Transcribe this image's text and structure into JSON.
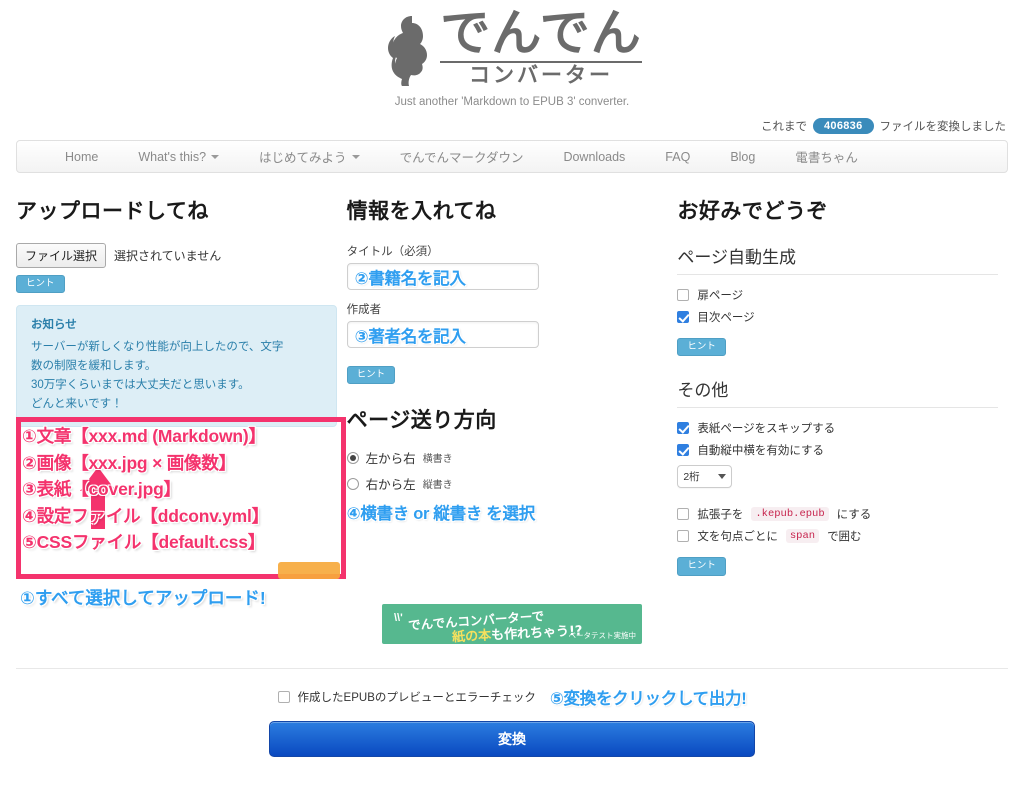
{
  "site": {
    "logo_main": "でんでん",
    "logo_sub": "コンバーター",
    "tagline": "Just another 'Markdown to EPUB 3' converter."
  },
  "counter": {
    "prefix": "これまで",
    "count": "406836",
    "suffix": "ファイルを変換しました"
  },
  "nav": {
    "items": [
      {
        "label": "Home",
        "caret": false
      },
      {
        "label": "What's this?",
        "caret": true
      },
      {
        "label": "はじめてみよう",
        "caret": true
      },
      {
        "label": "でんでんマークダウン",
        "caret": false
      },
      {
        "label": "Downloads",
        "caret": false
      },
      {
        "label": "FAQ",
        "caret": false
      },
      {
        "label": "Blog",
        "caret": false
      },
      {
        "label": "電書ちゃん",
        "caret": false
      }
    ]
  },
  "upload": {
    "heading": "アップロードしてね",
    "file_button": "ファイル選択",
    "file_status": "選択されていません",
    "hint_label": "ヒント",
    "notice": {
      "title": "お知らせ",
      "line1": "サーバーが新しくなり性能が向上したので、文字",
      "line2": "数の制限を緩和します。",
      "line3": "30万字くらいまでは大丈夫だと思います。",
      "line4": "どんと来いです！"
    },
    "annotation_list": [
      "①文章【xxx.md (Markdown)】",
      "②画像【xxx.jpg × 画像数】",
      "③表紙【cover.jpg】",
      "④設定ファイル【ddconv.yml】",
      "⑤CSSファイル【default.css】"
    ],
    "annotation_bottom": "①すべて選択してアップロード!"
  },
  "info": {
    "heading": "情報を入れてね",
    "title_label": "タイトル（必須）",
    "title_value": "②書籍名を記入",
    "title_placeholder": "",
    "author_label": "作成者",
    "author_value": "③著者名を記入",
    "author_placeholder": "",
    "hint_label": "ヒント",
    "direction_heading": "ページ送り方向",
    "radios": [
      {
        "main": "左から右",
        "sub": "横書き",
        "checked": true
      },
      {
        "main": "右から左",
        "sub": "縦書き",
        "checked": false
      }
    ],
    "annotation": "④横書き or 縦書き を選択"
  },
  "options": {
    "heading": "お好みでどうぞ",
    "autogen_heading": "ページ自動生成",
    "autogen_items": [
      {
        "label": "扉ページ",
        "checked": false
      },
      {
        "label": "目次ページ",
        "checked": true
      }
    ],
    "autogen_hint": "ヒント",
    "other_heading": "その他",
    "other_items": [
      {
        "label": "表紙ページをスキップする",
        "checked": true
      },
      {
        "label": "自動縦中横を有効にする",
        "checked": true
      }
    ],
    "digit_select": "2桁",
    "ext_item": {
      "pre": "拡張子を",
      "code": ".kepub.epub",
      "post": "にする",
      "checked": false
    },
    "span_item": {
      "pre": "文を句点ごとに",
      "code": "span",
      "post": "で囲む",
      "checked": false
    },
    "other_hint": "ヒント"
  },
  "banner": {
    "line1": "でんでんコンバーターで",
    "line2_a": "紙の本",
    "line2_b": "も作れちゃう!?",
    "beta": "ベータテスト実施中"
  },
  "footer": {
    "preview_label": "作成したEPUBのプレビューとエラーチェック",
    "preview_checked": false,
    "annotation": "⑤変換をクリックして出力!",
    "convert_button": "変換"
  },
  "colors": {
    "pink": "#f4336d",
    "blue_annot": "#2f9ef0",
    "hint_blue": "#5bafd6",
    "notice_bg": "#ddeef6",
    "banner_green": "#56b88f",
    "convert_blue": "#0a49c0"
  }
}
